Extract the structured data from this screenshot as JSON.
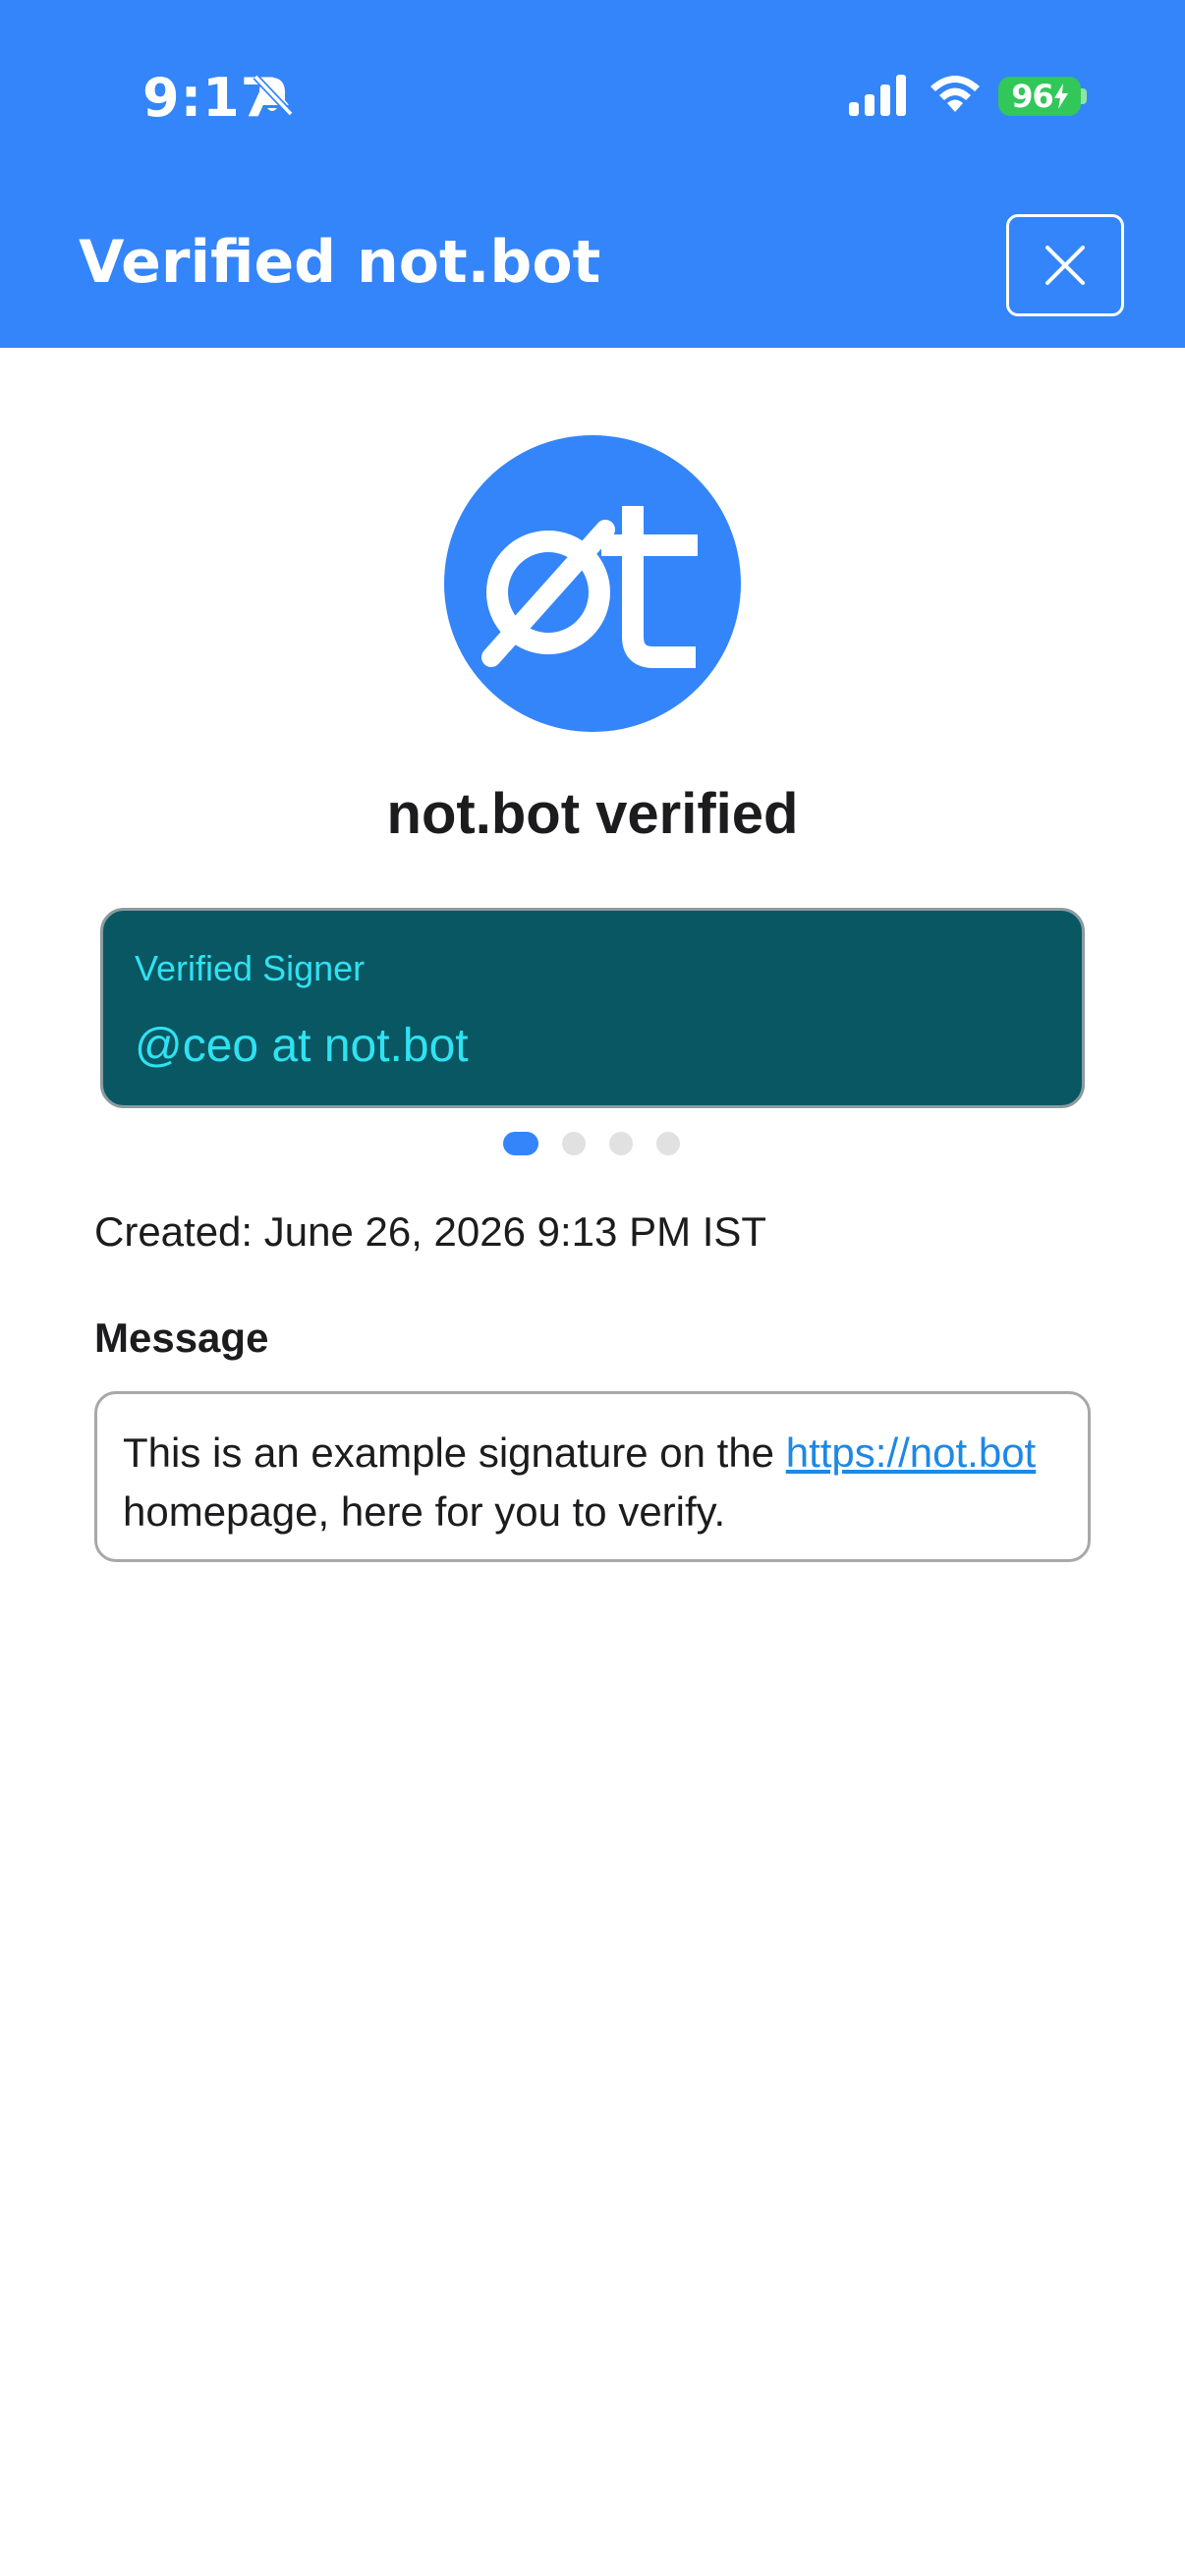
{
  "status_bar": {
    "time": "9:17",
    "battery": "96"
  },
  "header": {
    "title": "Verified not.bot",
    "close_icon": "close-icon"
  },
  "logo": {
    "icon": "not-bot-logo"
  },
  "verified_heading": "not.bot verified",
  "signer_card": {
    "label": "Verified Signer",
    "value": "@ceo at not.bot"
  },
  "pagination": {
    "count": 4,
    "active_index": 0
  },
  "created": "Created: June 26, 2026 9:13 PM IST",
  "message": {
    "heading": "Message",
    "text_before": "This is an example signature on the ",
    "link_text": "https://not.bot",
    "text_after": " homepage, here for you to verify."
  },
  "colors": {
    "brand": "#3485f9",
    "card_bg": "#095762",
    "card_text": "#2fe2f2",
    "link": "#1e88e5"
  }
}
